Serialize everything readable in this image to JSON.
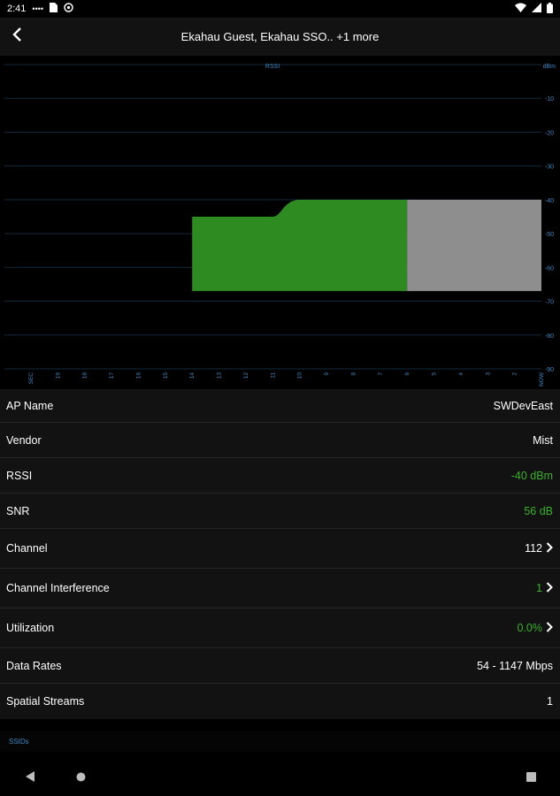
{
  "status_bar": {
    "time": "2:41",
    "dots": "••••",
    "icons": [
      "sim-icon",
      "data-saver-icon",
      "wifi-icon",
      "signal-icon",
      "battery-icon"
    ]
  },
  "app_bar": {
    "back_icon": "back-arrow-icon",
    "title": "Ekahau Guest, Ekahau SSO.. +1 more"
  },
  "chart_data": {
    "type": "area",
    "title": "RSSI",
    "y_unit_label": "dBm",
    "y_ticks": [
      "-10",
      "-20",
      "-30",
      "-40",
      "-50",
      "-60",
      "-70",
      "-80",
      "-90"
    ],
    "ylim": [
      0,
      -90
    ],
    "x_ticks": [
      "SEC",
      "19",
      "18",
      "17",
      "16",
      "15",
      "14",
      "13",
      "12",
      "11",
      "10",
      "9",
      "8",
      "7",
      "6",
      "5",
      "4",
      "3",
      "2",
      "NOW"
    ],
    "grid": true,
    "series": [
      {
        "color": "#2e8b22",
        "points": [
          [
            13,
            -45
          ],
          [
            10,
            -45
          ],
          [
            9,
            -40
          ],
          [
            5,
            -40
          ]
        ],
        "baseline": -67
      },
      {
        "color": "#8e8e8e",
        "points": [
          [
            5,
            -40
          ],
          [
            0,
            -40
          ]
        ],
        "baseline": -67
      }
    ]
  },
  "info": {
    "rows": [
      {
        "label": "AP Name",
        "value": "SWDevEast",
        "value_color": "",
        "chevron": false
      },
      {
        "label": "Vendor",
        "value": "Mist",
        "value_color": "",
        "chevron": false
      },
      {
        "label": "RSSI",
        "value": "-40 dBm",
        "value_color": "green",
        "chevron": false
      },
      {
        "label": "SNR",
        "value": "56 dB",
        "value_color": "green",
        "chevron": false
      },
      {
        "label": "Channel",
        "value": "112",
        "value_color": "",
        "chevron": true
      },
      {
        "label": "Channel Interference",
        "value": "1",
        "value_color": "green",
        "chevron": true
      },
      {
        "label": "Utilization",
        "value": "0.0%",
        "value_color": "green",
        "chevron": true
      },
      {
        "label": "Data Rates",
        "value": "54 - 1147 Mbps",
        "value_color": "",
        "chevron": false
      },
      {
        "label": "Spatial Streams",
        "value": "1",
        "value_color": "",
        "chevron": false
      }
    ]
  },
  "ssids_label": "SSIDs",
  "nav": {
    "back_icon": "nav-back-icon",
    "home_icon": "nav-home-icon",
    "recents_icon": "nav-recents-icon"
  },
  "colors": {
    "accent_green": "#3cb02c",
    "chart_axis_blue": "#3f88c5",
    "row_bg": "#121212"
  }
}
